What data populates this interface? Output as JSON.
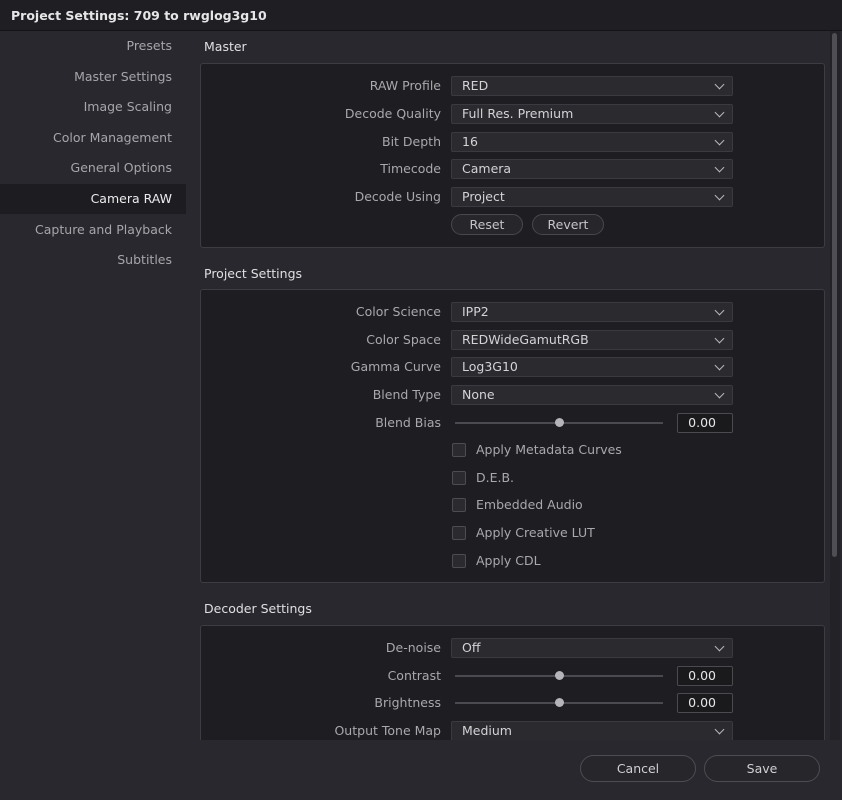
{
  "window": {
    "title": "Project Settings:  709 to rwglog3g10"
  },
  "sidebar": {
    "items": [
      {
        "label": "Presets"
      },
      {
        "label": "Master Settings"
      },
      {
        "label": "Image Scaling"
      },
      {
        "label": "Color Management"
      },
      {
        "label": "General Options"
      },
      {
        "label": "Camera RAW",
        "active": true
      },
      {
        "label": "Capture and Playback"
      },
      {
        "label": "Subtitles"
      }
    ]
  },
  "master": {
    "title": "Master",
    "raw_profile": {
      "label": "RAW Profile",
      "value": "RED"
    },
    "decode_quality": {
      "label": "Decode Quality",
      "value": "Full Res. Premium"
    },
    "bit_depth": {
      "label": "Bit Depth",
      "value": "16"
    },
    "timecode": {
      "label": "Timecode",
      "value": "Camera"
    },
    "decode_using": {
      "label": "Decode Using",
      "value": "Project"
    },
    "reset_label": "Reset",
    "revert_label": "Revert"
  },
  "project_settings": {
    "title": "Project Settings",
    "color_science": {
      "label": "Color Science",
      "value": "IPP2"
    },
    "color_space": {
      "label": "Color Space",
      "value": "REDWideGamutRGB"
    },
    "gamma_curve": {
      "label": "Gamma Curve",
      "value": "Log3G10"
    },
    "blend_type": {
      "label": "Blend Type",
      "value": "None"
    },
    "blend_bias": {
      "label": "Blend Bias",
      "value": "0.00",
      "slider_fraction": 0.5
    },
    "checkboxes": [
      {
        "label": "Apply Metadata Curves",
        "checked": false
      },
      {
        "label": "D.E.B.",
        "checked": false
      },
      {
        "label": "Embedded Audio",
        "checked": false
      },
      {
        "label": "Apply Creative LUT",
        "checked": false
      },
      {
        "label": "Apply CDL",
        "checked": false
      }
    ]
  },
  "decoder_settings": {
    "title": "Decoder Settings",
    "denoise": {
      "label": "De-noise",
      "value": "Off"
    },
    "contrast": {
      "label": "Contrast",
      "value": "0.00",
      "slider_fraction": 0.5
    },
    "brightness": {
      "label": "Brightness",
      "value": "0.00",
      "slider_fraction": 0.5
    },
    "output_tone_map": {
      "label": "Output Tone Map",
      "value": "Medium"
    }
  },
  "footer": {
    "cancel_label": "Cancel",
    "save_label": "Save"
  },
  "colors": {
    "background": "#28282e",
    "panel": "#1e1e22",
    "active_item": "#1d1d21",
    "text": "#b4b4b8"
  }
}
